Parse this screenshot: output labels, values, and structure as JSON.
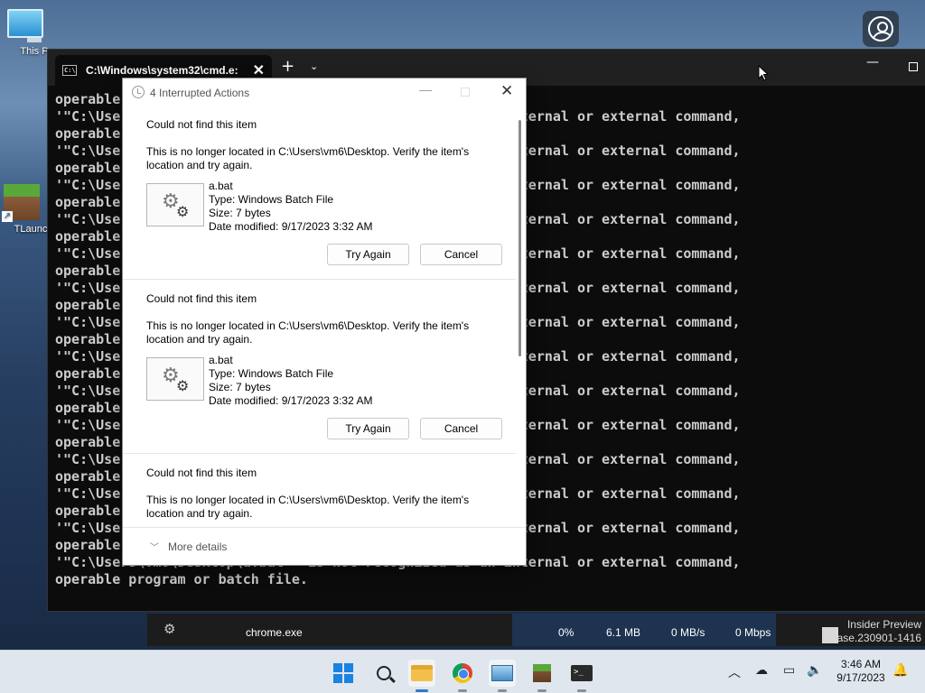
{
  "desktop": {
    "icons": [
      {
        "label": "This P"
      },
      {
        "label": "TLaunc"
      }
    ]
  },
  "terminal": {
    "tab_title": "C:\\Windows\\system32\\cmd.e:",
    "tab_close": "✕",
    "new_tab": "+",
    "dropdown": "⌄",
    "minimize": "—",
    "lines": [
      "operable program or batch file.",
      "'\"C:\\Users\\vm6\\Desktop\\a.bat\"' is not recognized as an internal or external command,",
      "operable program or batch file.",
      "'\"C:\\Users\\vm6\\Desktop\\a.bat\"' is not recognized as an internal or external command,",
      "operable program or batch file.",
      "'\"C:\\Users\\vm6\\Desktop\\a.bat\"' is not recognized as an internal or external command,",
      "operable program or batch file.",
      "'\"C:\\Users\\vm6\\Desktop\\a.bat\"' is not recognized as an internal or external command,",
      "operable program or batch file.",
      "'\"C:\\Users\\vm6\\Desktop\\a.bat\"' is not recognized as an internal or external command,",
      "operable program or batch file.",
      "'\"C:\\Users\\vm6\\Desktop\\a.bat\"' is not recognized as an internal or external command,",
      "operable program or batch file.",
      "'\"C:\\Users\\vm6\\Desktop\\a.bat\"' is not recognized as an internal or external command,",
      "operable program or batch file.",
      "'\"C:\\Users\\vm6\\Desktop\\a.bat\"' is not recognized as an internal or external command,",
      "operable program or batch file.",
      "'\"C:\\Users\\vm6\\Desktop\\a.bat\"' is not recognized as an internal or external command,",
      "operable program or batch file.",
      "'\"C:\\Users\\vm6\\Desktop\\a.bat\"' is not recognized as an internal or external command,",
      "operable program or batch file.",
      "'\"C:\\Users\\vm6\\Desktop\\a.bat\"' is not recognized as an internal or external command,",
      "operable program or batch file.",
      "'\"C:\\Users\\vm6\\Desktop\\a.bat\"' is not recognized as an internal or external command,",
      "operable program or batch file.",
      "'\"C:\\Users\\vm6\\Desktop\\a.bat\"' is not recognized as an internal or external command,",
      "operable program or batch file.",
      "'\"C:\\Users\\vm6\\Desktop\\a.bat\"' is not recognized as an internal or external command,",
      "operable program or batch file."
    ]
  },
  "taskmgr": {
    "process": "chrome.exe",
    "cpu": "0%",
    "memory": "6.1 MB",
    "disk": "0 MB/s",
    "network": "0 Mbps"
  },
  "watermark": {
    "line1": "Insider Preview",
    "line2": "ase.230901-1416"
  },
  "dialog": {
    "title": "4 Interrupted Actions",
    "items": [
      {
        "heading": "Could not find this item",
        "message": "This is no longer located in C:\\Users\\vm6\\Desktop. Verify the item's location and try again.",
        "filename": "a.bat",
        "type": "Type: Windows Batch File",
        "size": "Size: 7 bytes",
        "modified": "Date modified: 9/17/2023 3:32 AM",
        "try_again": "Try Again",
        "cancel": "Cancel"
      },
      {
        "heading": "Could not find this item",
        "message": "This is no longer located in C:\\Users\\vm6\\Desktop. Verify the item's location and try again.",
        "filename": "a.bat",
        "type": "Type: Windows Batch File",
        "size": "Size: 7 bytes",
        "modified": "Date modified: 9/17/2023 3:32 AM",
        "try_again": "Try Again",
        "cancel": "Cancel"
      },
      {
        "heading": "Could not find this item",
        "message": "This is no longer located in C:\\Users\\vm6\\Desktop. Verify the item's location and try again."
      }
    ],
    "more_details": "More details"
  },
  "taskbar": {
    "time": "3:46 AM",
    "date": "9/17/2023"
  }
}
